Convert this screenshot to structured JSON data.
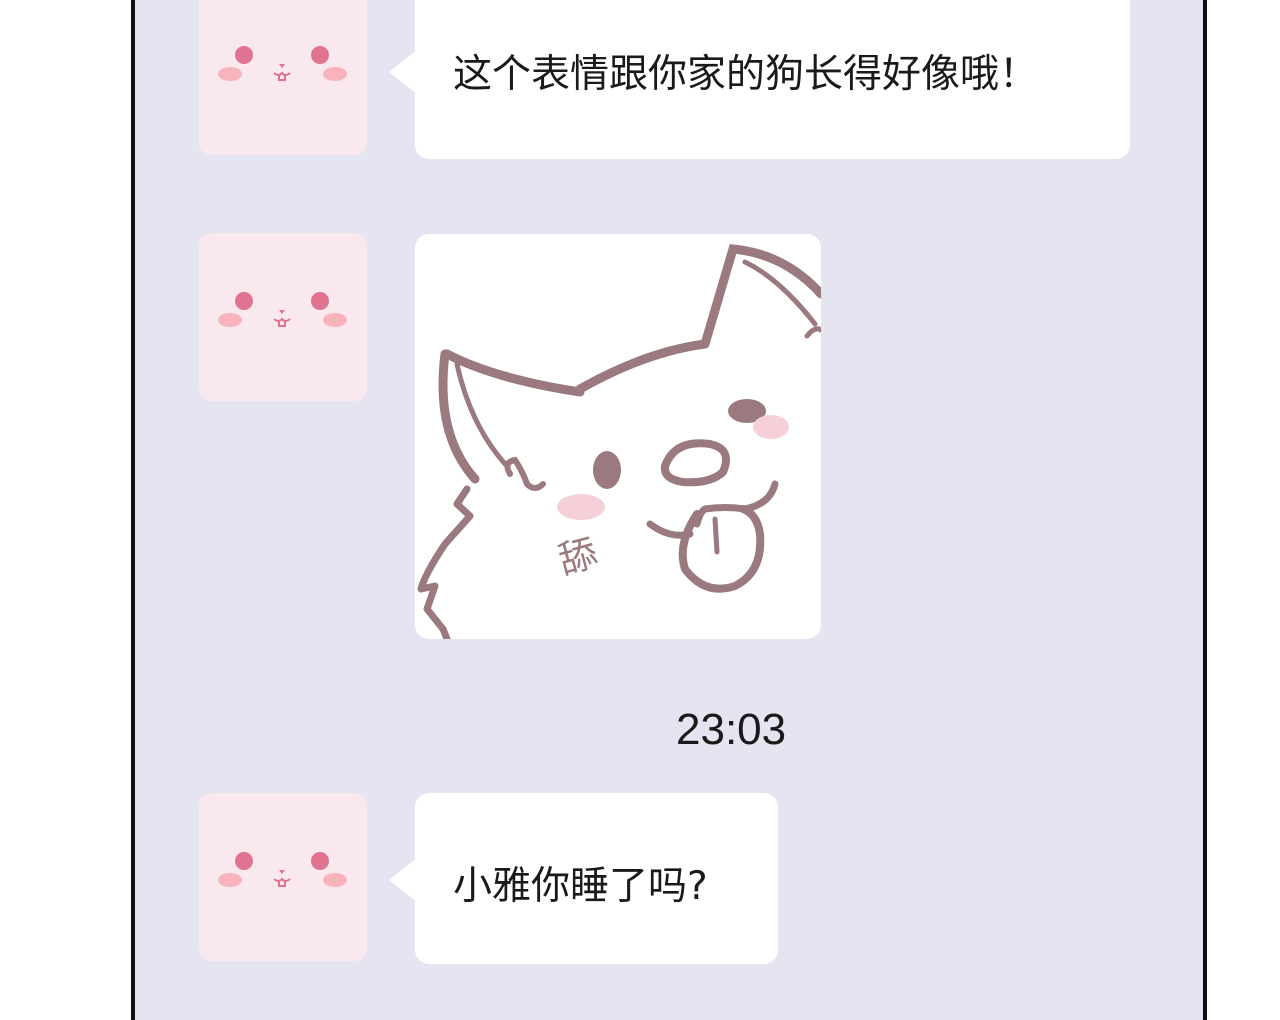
{
  "messages": [
    {
      "type": "text",
      "text": "这个表情跟你家的狗长得好像哦！"
    },
    {
      "type": "sticker",
      "sticker_text": "舔"
    },
    {
      "type": "timestamp",
      "text": "23:03"
    },
    {
      "type": "text",
      "text": "小雅你睡了吗?"
    }
  ],
  "colors": {
    "background": "#e5e5f1",
    "bubble": "#ffffff",
    "avatar_bg": "#f9e8ee",
    "avatar_eye": "#e0738f",
    "avatar_blush": "#f8b3bd",
    "sticker_line": "#9a7a7e"
  }
}
